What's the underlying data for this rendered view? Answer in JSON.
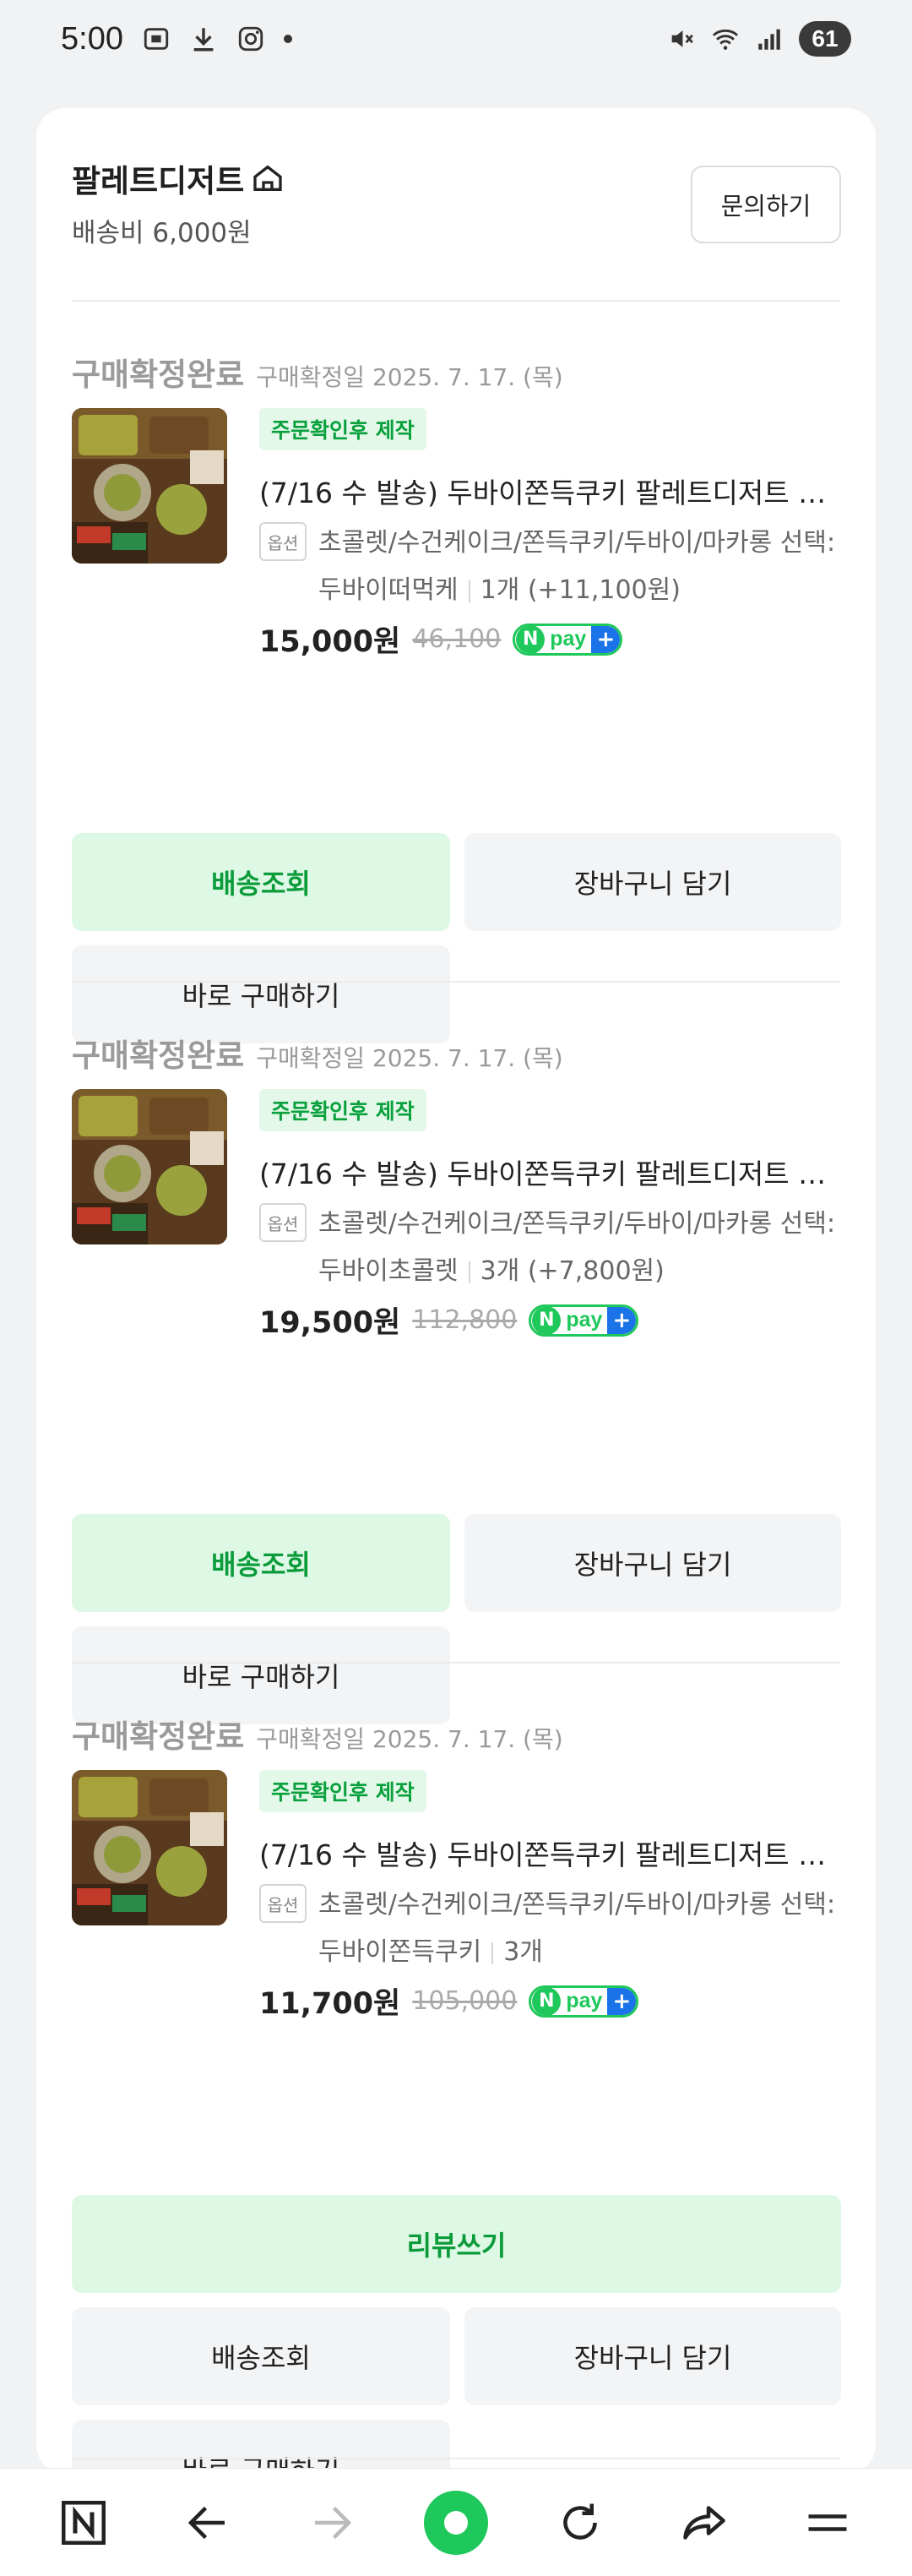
{
  "status_bar": {
    "time": "5:00",
    "battery": "61"
  },
  "seller": {
    "name": "팔레트디저트",
    "shipping_fee": "배송비 6,000원",
    "inquiry_label": "문의하기"
  },
  "orders": [
    {
      "status": "구매확정완료",
      "date": "구매확정일 2025. 7. 17. (목)",
      "badge": "주문확인후 제작",
      "title": "(7/16 수 발송) 두바이쫀득쿠키 팔레트디저트 2…",
      "option_tag": "옵션",
      "option_line1": "초콜렛/수건케이크/쫀득쿠키/두바이/마카롱 선택:",
      "option_name": "두바이떠먹케",
      "option_qty": "1개 (+11,100원)",
      "price": "15,000원",
      "original_price": "46,100",
      "buttons": {
        "track": "배송조회",
        "cart": "장바구니 담기",
        "buy_again": "바로 구매하기"
      }
    },
    {
      "status": "구매확정완료",
      "date": "구매확정일 2025. 7. 17. (목)",
      "badge": "주문확인후 제작",
      "title": "(7/16 수 발송) 두바이쫀득쿠키 팔레트디저트 2…",
      "option_tag": "옵션",
      "option_line1": "초콜렛/수건케이크/쫀득쿠키/두바이/마카롱 선택:",
      "option_name": "두바이초콜렛",
      "option_qty": "3개 (+7,800원)",
      "price": "19,500원",
      "original_price": "112,800",
      "buttons": {
        "track": "배송조회",
        "cart": "장바구니 담기",
        "buy_again": "바로 구매하기"
      }
    },
    {
      "status": "구매확정완료",
      "date": "구매확정일 2025. 7. 17. (목)",
      "badge": "주문확인후 제작",
      "title": "(7/16 수 발송) 두바이쫀득쿠키 팔레트디저트 2…",
      "option_tag": "옵션",
      "option_line1": "초콜렛/수건케이크/쫀득쿠키/두바이/마카롱 선택:",
      "option_name": "두바이쫀득쿠키",
      "option_qty": "3개",
      "price": "11,700원",
      "original_price": "105,000",
      "buttons": {
        "review": "리뷰쓰기",
        "track": "배송조회",
        "cart": "장바구니 담기",
        "buy_again": "바로 구매하기"
      }
    }
  ],
  "npay": {
    "n": "N",
    "pay": "pay",
    "plus": "+"
  },
  "colors": {
    "accent_green": "#1ec85a",
    "button_green_bg": "#ddf8e4",
    "button_green_text": "#0b9b3a"
  }
}
